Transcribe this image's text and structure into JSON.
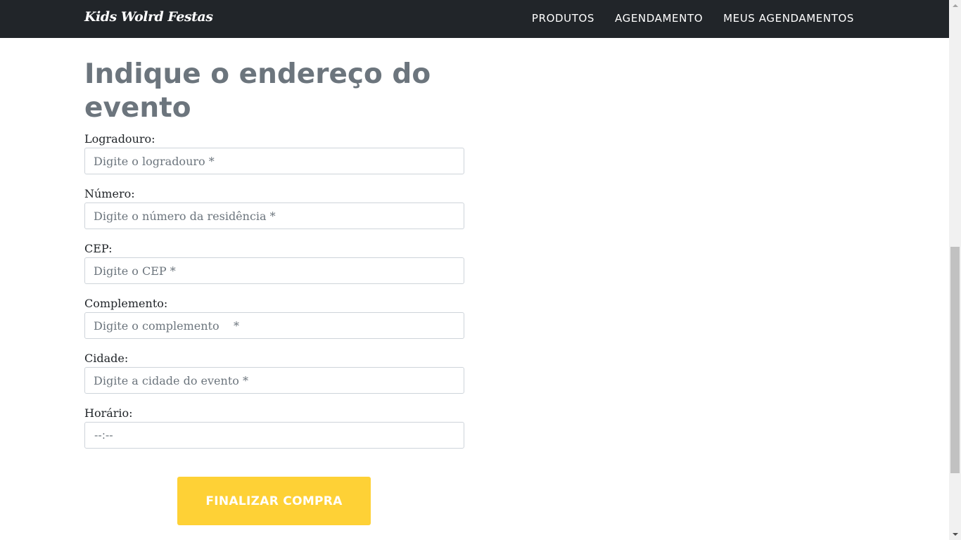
{
  "navbar": {
    "brand": "Kids Wolrd Festas",
    "links": [
      "PRODUTOS",
      "AGENDAMENTO",
      "MEUS AGENDAMENTOS"
    ]
  },
  "page": {
    "title": "Indique o endereço do evento"
  },
  "form": {
    "logradouro": {
      "label": "Logradouro:",
      "placeholder": "Digite o logradouro *",
      "value": ""
    },
    "numero": {
      "label": "Número:",
      "placeholder": "Digite o número da residência *",
      "value": ""
    },
    "cep": {
      "label": "CEP:",
      "placeholder": "Digite o CEP *",
      "value": ""
    },
    "complemento": {
      "label": "Complemento:",
      "placeholder": "Digite o complemento    *",
      "value": ""
    },
    "cidade": {
      "label": "Cidade:",
      "placeholder": "Digite a cidade do evento *",
      "value": ""
    },
    "horario": {
      "label": "Horário:",
      "value": "--:--"
    }
  },
  "actions": {
    "submit_label": "FINALIZAR COMPRA"
  },
  "colors": {
    "navbar_bg": "#212529",
    "title": "#6c757d",
    "accent": "#fed136"
  }
}
